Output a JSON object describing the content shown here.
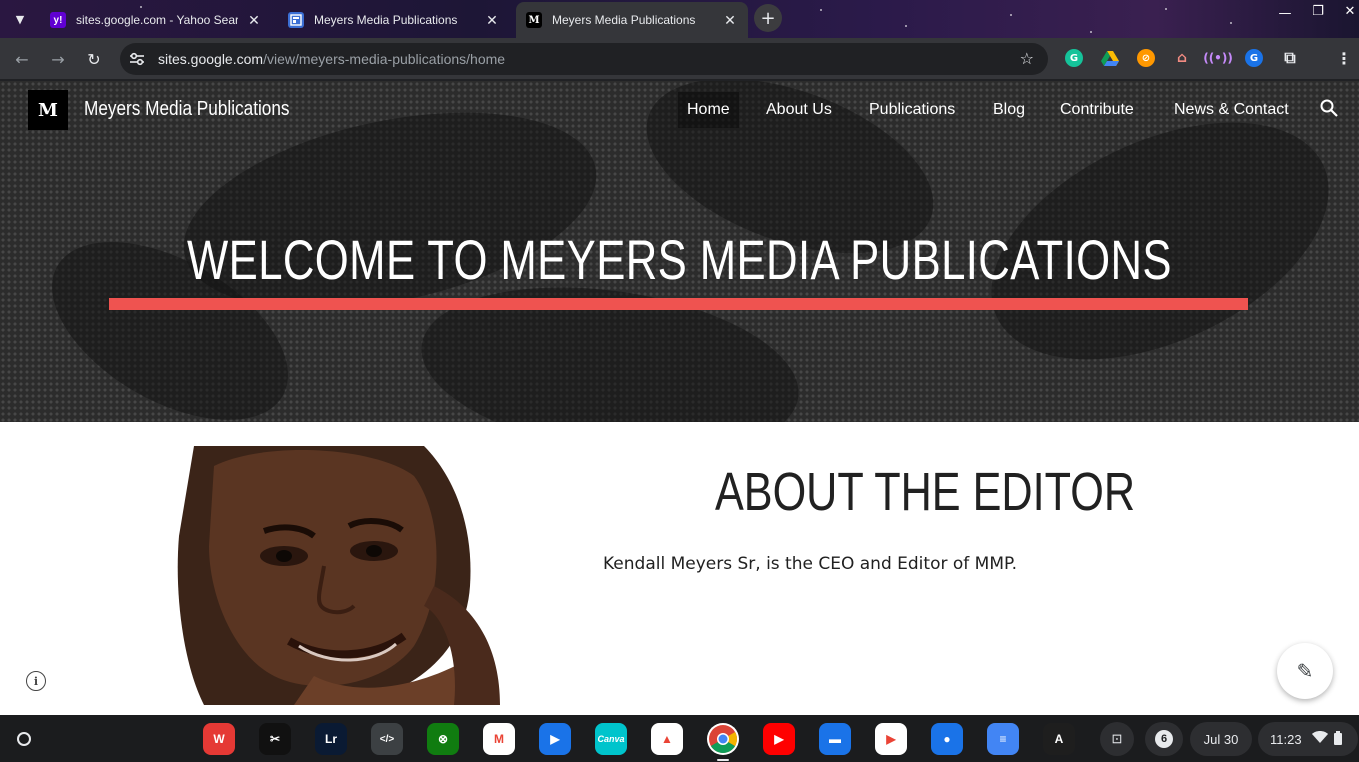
{
  "browser": {
    "tabs": [
      {
        "title": "sites.google.com - Yahoo Search",
        "favicon": "yahoo-icon",
        "favicon_text": "y!",
        "active": false
      },
      {
        "title": "Meyers Media Publications",
        "favicon": "google-sites-icon",
        "favicon_text": "",
        "active": false
      },
      {
        "title": "Meyers Media Publications",
        "favicon": "site-logo-icon",
        "favicon_text": "M",
        "active": true
      }
    ],
    "url_host": "sites.google.com",
    "url_path": "/view/meyers-media-publications/home"
  },
  "site": {
    "logo_letter": "M",
    "title": "Meyers Media Publications",
    "nav": [
      "Home",
      "About Us",
      "Publications",
      "Blog",
      "Contribute",
      "News & Contact"
    ],
    "hero_title": "WELCOME TO MEYERS MEDIA PUBLICATIONS",
    "accent_color": "#ef5350",
    "about_title": "ABOUT THE EDITOR",
    "about_text": "Kendall Meyers Sr, is the CEO and Editor of MMP."
  },
  "shelf": {
    "apps": [
      {
        "name": "wps-office-icon",
        "label": "W",
        "color": "#e53935"
      },
      {
        "name": "capcut-icon",
        "label": "✂",
        "color": "#111111"
      },
      {
        "name": "lightroom-icon",
        "label": "Lr",
        "color": "#0a1a33"
      },
      {
        "name": "code-editor-icon",
        "label": "</>",
        "color": "#3c4043"
      },
      {
        "name": "xbox-game-pass-icon",
        "label": "⊗",
        "color": "#107c10"
      },
      {
        "name": "gmail-icon",
        "label": "M",
        "color": "#ffffff"
      },
      {
        "name": "media-player-icon",
        "label": "▶",
        "color": "#1a73e8"
      },
      {
        "name": "canva-icon",
        "label": "Canva",
        "color": "#00c4cc"
      },
      {
        "name": "google-drive-icon",
        "label": "▲",
        "color": "#ffffff"
      },
      {
        "name": "chrome-icon",
        "label": "",
        "color": "#ffffff"
      },
      {
        "name": "youtube-icon",
        "label": "▶",
        "color": "#ff0000"
      },
      {
        "name": "files-icon",
        "label": "▬",
        "color": "#1a73e8"
      },
      {
        "name": "play-store-icon",
        "label": "▶",
        "color": "#ffffff"
      },
      {
        "name": "messages-icon",
        "label": "●",
        "color": "#1a73e8"
      },
      {
        "name": "google-docs-icon",
        "label": "≡",
        "color": "#4285f4"
      },
      {
        "name": "adobe-express-icon",
        "label": "A",
        "color": "#1e1e1e"
      }
    ],
    "notification_count": "6",
    "date": "Jul 30",
    "time": "11:23"
  }
}
